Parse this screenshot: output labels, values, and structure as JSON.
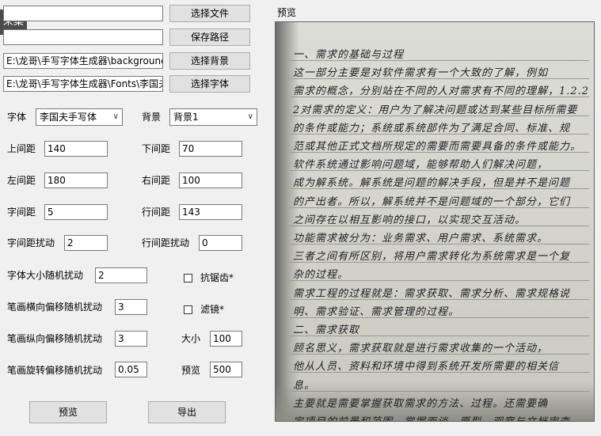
{
  "capture_tab": {
    "label": "采集"
  },
  "file_rows": [
    {
      "value": "",
      "button": "选择文件"
    },
    {
      "value": "",
      "button": "保存路径"
    },
    {
      "value": "E:\\龙哥\\手写字体生成器\\background",
      "button": "选择背景"
    },
    {
      "value": "E:\\龙哥\\手写字体生成器\\Fonts\\李国夫",
      "button": "选择字体"
    }
  ],
  "font": {
    "label": "字体",
    "value": "李国夫手写体"
  },
  "background": {
    "label": "背景",
    "value": "背景1"
  },
  "fields": {
    "top_margin": {
      "label": "上间距",
      "value": "140"
    },
    "bottom_margin": {
      "label": "下间距",
      "value": "70"
    },
    "left_margin": {
      "label": "左间距",
      "value": "180"
    },
    "right_margin": {
      "label": "右间距",
      "value": "100"
    },
    "char_spacing": {
      "label": "字间距",
      "value": "5"
    },
    "line_spacing": {
      "label": "行间距",
      "value": "143"
    },
    "char_spacing_jitter": {
      "label": "字间距扰动",
      "value": "2"
    },
    "line_spacing_jitter": {
      "label": "行间距扰动",
      "value": "0"
    },
    "font_size_jitter": {
      "label": "字体大小随机扰动",
      "value": "2"
    },
    "stroke_h_offset": {
      "label": "笔画横向偏移随机扰动",
      "value": "3"
    },
    "stroke_v_offset": {
      "label": "笔画纵向偏移随机扰动",
      "value": "3"
    },
    "stroke_rotate_offset": {
      "label": "笔画旋转偏移随机扰动",
      "value": "0.05"
    },
    "size": {
      "label": "大小",
      "value": "100"
    },
    "preview_value": {
      "label": "预览",
      "value": "500"
    }
  },
  "checkboxes": {
    "antialias": {
      "label": "抗锯齿*",
      "checked": false
    },
    "filter": {
      "label": "滤镜*",
      "checked": false
    }
  },
  "buttons": {
    "preview": "预览",
    "export": "导出"
  },
  "preview_panel": {
    "title": "预览",
    "lines": [
      "一、需求的基础与过程",
      "这一部分主要是对软件需求有一个大致的了解，例如",
      "需求的概念，分别站在不同的人对需求有不同的理解，1.2.2",
      "2对需求的定义：用户为了解决问题或达到某些目标所需要",
      "的条件或能力；系统或系统部件为了满足合同、标准、规",
      "范或其他正式文档所规定的需要而需要具备的条件或能力。",
      "软件系统通过影响问题域，能够帮助人们解决问题，",
      "成为解系统。解系统是问题的解决手段，但是并不是问题",
      "的产出者。所以，解系统并不是问题域的一个部分，它们",
      "之间存在以相互影响的接口，以实现交互活动。",
      "功能需求被分为：业务需求、用户需求、系统需求。",
      "三者之间有所区别，将用户需求转化为系统需求是一个复",
      "杂的过程。",
      "需求工程的过程就是：需求获取、需求分析、需求规格说",
      "明、需求验证、需求管理的过程。",
      "二、需求获取",
      "顾名思义，需求获取就是进行需求收集的一个活动，",
      "他从人员、资料和环境中得到系统开发所需要的相关信",
      "息。",
      "主要就是需要掌握获取需求的方法、过程。还需要确",
      "定项目的前景和范围，掌握面谈、原型、观察与文档审查"
    ]
  },
  "colors": {
    "window_bg": "#f0f0f0",
    "button_bg": "#e1e1e1",
    "capture_tab_bg": "#4b4b4b",
    "ink": "#1e1e24"
  }
}
